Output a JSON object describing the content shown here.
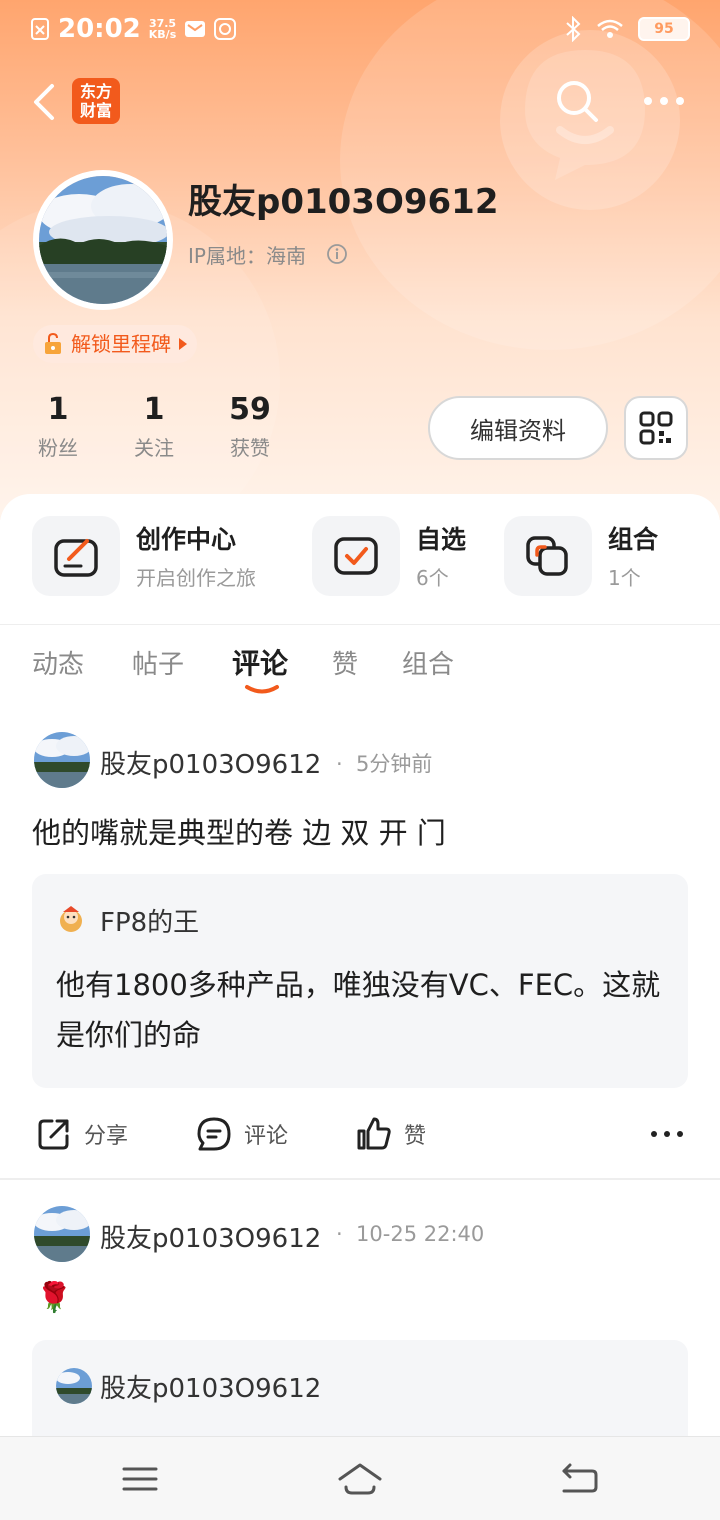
{
  "status_bar": {
    "time": "20:02",
    "net_speed_value": "37.5",
    "net_speed_unit": "KB/s",
    "battery": "95"
  },
  "header": {
    "logo_text_line1": "东方",
    "logo_text_line2": "财富"
  },
  "profile": {
    "username": "股友p0103O9612",
    "ip_location": "IP属地：海南",
    "badge": "解锁里程碑",
    "stats": [
      {
        "value": "1",
        "label": "粉丝"
      },
      {
        "value": "1",
        "label": "关注"
      },
      {
        "value": "59",
        "label": "获赞"
      }
    ],
    "edit_button": "编辑资料"
  },
  "shortcuts": [
    {
      "title": "创作中心",
      "subtitle": "开启创作之旅"
    },
    {
      "title": "自选",
      "subtitle": "6个"
    },
    {
      "title": "组合",
      "subtitle": "1个"
    }
  ],
  "tabs": [
    "动态",
    "帖子",
    "评论",
    "赞",
    "组合"
  ],
  "active_tab": "评论",
  "posts": [
    {
      "author": "股友p0103O9612",
      "time": "5分钟前",
      "text": "他的嘴就是典型的卷 边 双 开 门",
      "quote_user": "FP8的王",
      "quote_text": "他有1800多种产品，唯独没有VC、FEC。这就是你们的命"
    },
    {
      "author": "股友p0103O9612",
      "time": "10-25 22:40",
      "text": "🌹",
      "quote_user": "股友p0103O9612"
    }
  ],
  "actions": {
    "share": "分享",
    "comment": "评论",
    "like": "赞"
  },
  "colors": {
    "accent": "#f25a1c",
    "hero_top": "#ffa56e"
  }
}
